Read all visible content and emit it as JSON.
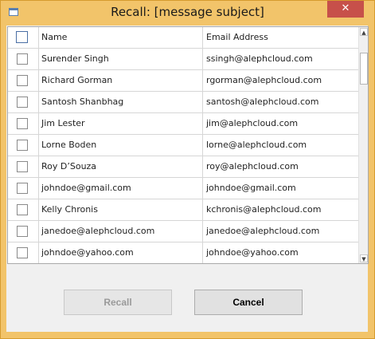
{
  "window": {
    "title": "Recall: [message subject]",
    "close_glyph": "✕",
    "app_icon": "window-icon"
  },
  "table": {
    "headers": {
      "name": "Name",
      "email": "Email Address"
    },
    "rows": [
      {
        "name": "Surender Singh",
        "email": "ssingh@alephcloud.com"
      },
      {
        "name": "Richard Gorman",
        "email": "rgorman@alephcloud.com"
      },
      {
        "name": "Santosh Shanbhag",
        "email": "santosh@alephcloud.com"
      },
      {
        "name": "Jim Lester",
        "email": "jim@alephcloud.com"
      },
      {
        "name": "Lorne Boden",
        "email": "lorne@alephcloud.com"
      },
      {
        "name": "Roy D’Souza",
        "email": "roy@alephcloud.com"
      },
      {
        "name": "johndoe@gmail.com",
        "email": "johndoe@gmail.com"
      },
      {
        "name": "Kelly Chronis",
        "email": "kchronis@alephcloud.com"
      },
      {
        "name": "janedoe@alephcloud.com",
        "email": "janedoe@alephcloud.com"
      },
      {
        "name": "johndoe@yahoo.com",
        "email": "johndoe@yahoo.com"
      }
    ]
  },
  "buttons": {
    "recall": "Recall",
    "cancel": "Cancel"
  },
  "colors": {
    "frame": "#f2c46a",
    "close": "#c7504a",
    "client": "#f0f0f0"
  }
}
